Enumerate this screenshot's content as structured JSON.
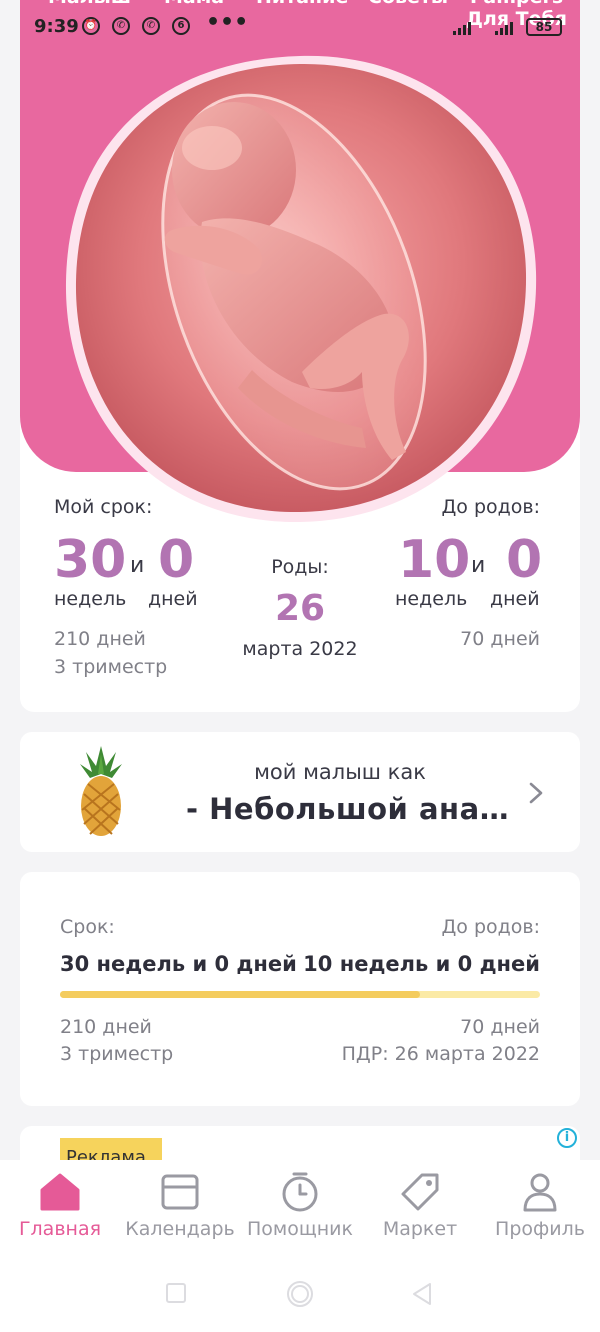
{
  "colors": {
    "brand_pink": "#e8689f",
    "accent_purple": "#b274b2",
    "progress": "#f4cc5e",
    "active_nav": "#e55a97"
  },
  "status_bar": {
    "time": "9:39",
    "icons": [
      "alarm-icon",
      "viber-icon",
      "viber-icon",
      "notification-6-icon"
    ],
    "more": "•••",
    "battery": "85"
  },
  "top_tabs": [
    "Малыш",
    "Мама",
    "Питание",
    "Советы",
    "Pampers"
  ],
  "top_tab_extra": "Для Тебя",
  "hero": {
    "my_term_label": "Мой срок:",
    "weeks": "30",
    "and_word": "и",
    "days": "0",
    "weeks_unit": "недель",
    "days_unit": "дней",
    "total_days": "210 дней",
    "trimester": "3 триместр",
    "birth_label": "Роды:",
    "birth_day": "26",
    "birth_month": "марта 2022",
    "until_label": "До родов:",
    "until_weeks": "10",
    "until_days": "0",
    "until_total_days": "70 дней"
  },
  "fruit_card": {
    "subtitle": "мой малыш как",
    "title": "- Небольшой ана…",
    "icon": "pineapple-icon"
  },
  "progress_card": {
    "term_label": "Срок:",
    "term_value": "30 недель и 0 дней",
    "until_label": "До родов:",
    "until_value": "10 недель и 0 дней",
    "progress_fraction": 0.75,
    "days_elapsed": "210 дней",
    "trimester": "3 триместр",
    "days_left": "70 дней",
    "due_date": "ПДР: 26 марта 2022"
  },
  "ad": {
    "tag": "Реклама",
    "info": "i"
  },
  "bottom_nav": [
    {
      "label": "Главная",
      "icon": "home-icon",
      "active": true
    },
    {
      "label": "Календарь",
      "icon": "calendar-icon",
      "active": false
    },
    {
      "label": "Помощник",
      "icon": "stopwatch-icon",
      "active": false
    },
    {
      "label": "Маркет",
      "icon": "tag-icon",
      "active": false
    },
    {
      "label": "Профиль",
      "icon": "profile-icon",
      "active": false
    }
  ]
}
